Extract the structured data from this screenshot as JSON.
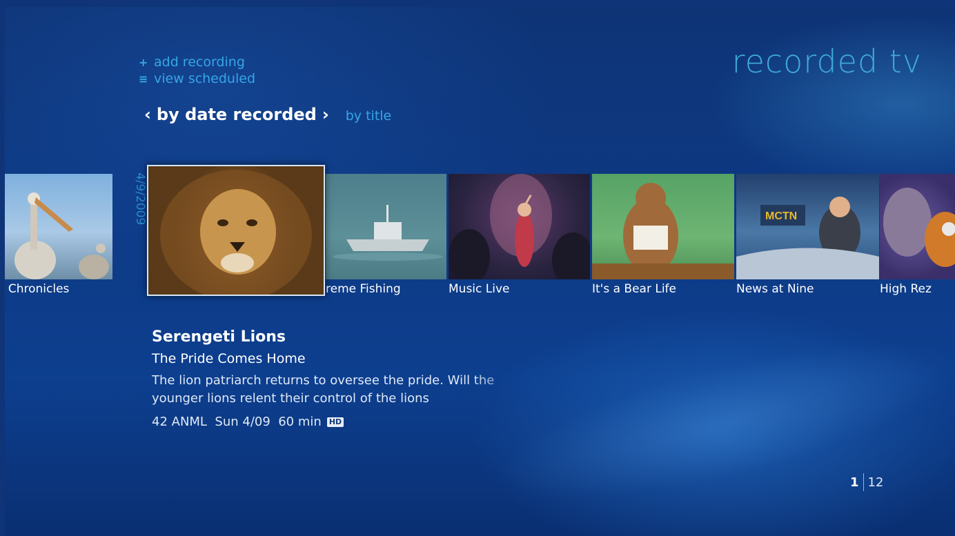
{
  "header": {
    "title": "recorded tv"
  },
  "menu": {
    "items": [
      {
        "icon": "plus-icon",
        "label": "add recording"
      },
      {
        "icon": "list-icon",
        "label": "view scheduled"
      }
    ]
  },
  "sort": {
    "active_label": "by date recorded",
    "left_chevron": "‹",
    "right_chevron": "›",
    "other_label": "by title"
  },
  "strip": {
    "date_label": "4/9/2009",
    "items": [
      {
        "title": "elican Chronicles",
        "thumb": "pelican"
      },
      {
        "title": "Serengeti Lions",
        "thumb": "lion",
        "selected": true
      },
      {
        "title": "reme Fishing",
        "thumb": "fishing"
      },
      {
        "title": "Music Live",
        "thumb": "music"
      },
      {
        "title": "It's a Bear Life",
        "thumb": "bear"
      },
      {
        "title": "News at Nine",
        "thumb": "news"
      },
      {
        "title": "High Rez",
        "thumb": "highrez"
      }
    ]
  },
  "details": {
    "title": "Serengeti Lions",
    "episode": "The Pride Comes Home",
    "description": "The lion patriarch returns to oversee the pride. Will the younger lions relent their control of the lions",
    "meta": "42 ANML  Sun 4/09  60 min",
    "hd_badge": "HD"
  },
  "pager": {
    "current": "1",
    "total": "12"
  }
}
